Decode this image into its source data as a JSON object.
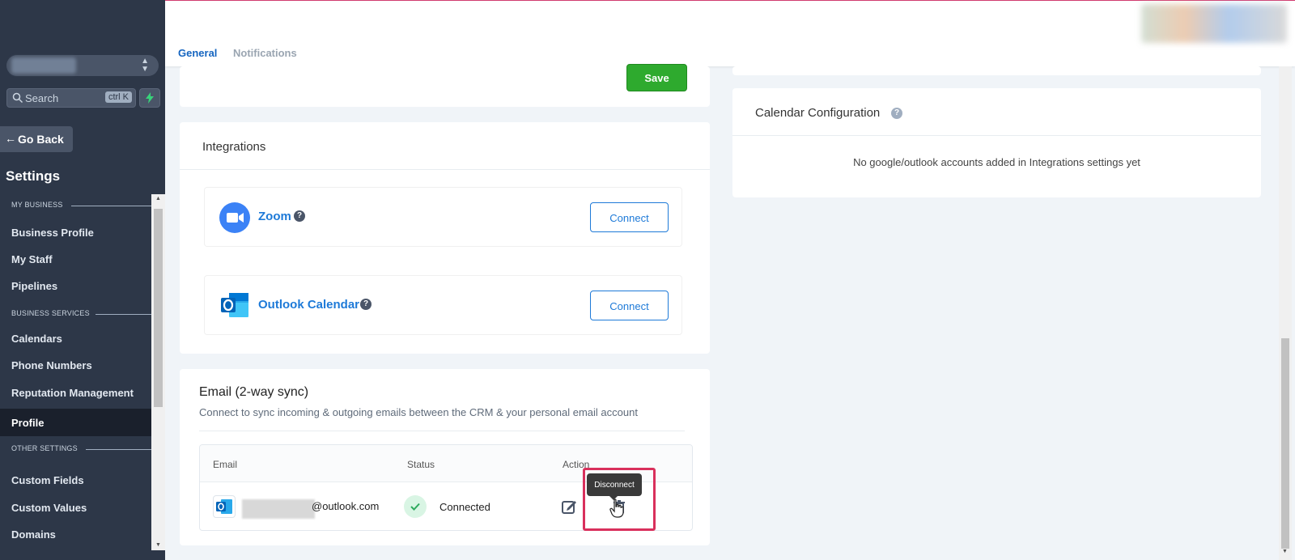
{
  "sidebar": {
    "search_placeholder": "Search",
    "search_shortcut": "ctrl K",
    "go_back": "Go Back",
    "title": "Settings",
    "sections": [
      {
        "heading": "MY BUSINESS"
      },
      {
        "heading": "BUSINESS SERVICES"
      },
      {
        "heading": "OTHER SETTINGS"
      }
    ],
    "items": [
      {
        "label": "Business Profile"
      },
      {
        "label": "My Staff"
      },
      {
        "label": "Pipelines"
      },
      {
        "label": "Calendars"
      },
      {
        "label": "Phone Numbers"
      },
      {
        "label": "Reputation Management"
      },
      {
        "label": "Profile",
        "active": true
      },
      {
        "label": "Custom Fields"
      },
      {
        "label": "Custom Values"
      },
      {
        "label": "Domains"
      }
    ]
  },
  "header": {
    "tabs": [
      {
        "label": "General",
        "active": true
      },
      {
        "label": "Notifications"
      }
    ]
  },
  "top_card": {
    "save_label": "Save"
  },
  "integrations": {
    "title": "Integrations",
    "items": [
      {
        "name": "Zoom",
        "icon": "zoom-icon",
        "button": "Connect"
      },
      {
        "name": "Outlook Calendar",
        "icon": "outlook-icon",
        "button": "Connect"
      }
    ]
  },
  "email_sync": {
    "title": "Email (2-way sync)",
    "subtitle": "Connect to sync incoming & outgoing emails between the CRM & your personal email account",
    "columns": [
      "Email",
      "Status",
      "Action"
    ],
    "row": {
      "email_suffix": "@outlook.com",
      "status": "Connected"
    },
    "tooltip": "Disconnect"
  },
  "calendar_config": {
    "title": "Calendar Configuration",
    "empty_message": "No google/outlook accounts added in Integrations settings yet"
  },
  "colors": {
    "sidebar_bg": "#2d3748",
    "accent_blue": "#1e7ad8",
    "save_green": "#2eaa2e",
    "highlight": "#d9305c"
  }
}
